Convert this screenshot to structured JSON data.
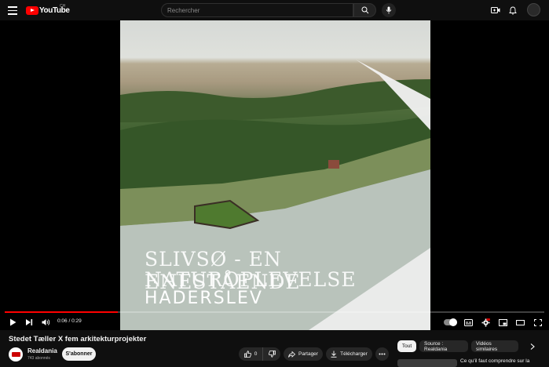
{
  "header": {
    "logo_text": "YouTube",
    "country_code": "CH",
    "search_placeholder": "Rechercher"
  },
  "video": {
    "overlay_line1": "SLIVSØ - EN ENESTÅENDE",
    "overlay_line2": "NATUROPLEVELSE",
    "overlay_line3": "HADERSLEV",
    "progress": 0.21,
    "time_current": "0:06",
    "time_total": "0:29",
    "time_display": "0:06 / 0:29"
  },
  "info": {
    "title": "Stedet Tæller X fem arkitekturprojekter",
    "channel_name": "Realdania",
    "subscribers": "743 abonnés",
    "subscribe_label": "S'abonner",
    "like_count": "0",
    "share_label": "Partager",
    "download_label": "Télécharger"
  },
  "chips": [
    "Tout",
    "Source : Realdania",
    "Vidéos similaires"
  ],
  "recommendation": {
    "title": "Ce qu'il faut comprendre sur la"
  },
  "colors": {
    "accent": "#ff0000",
    "background": "#0f0f0f"
  }
}
